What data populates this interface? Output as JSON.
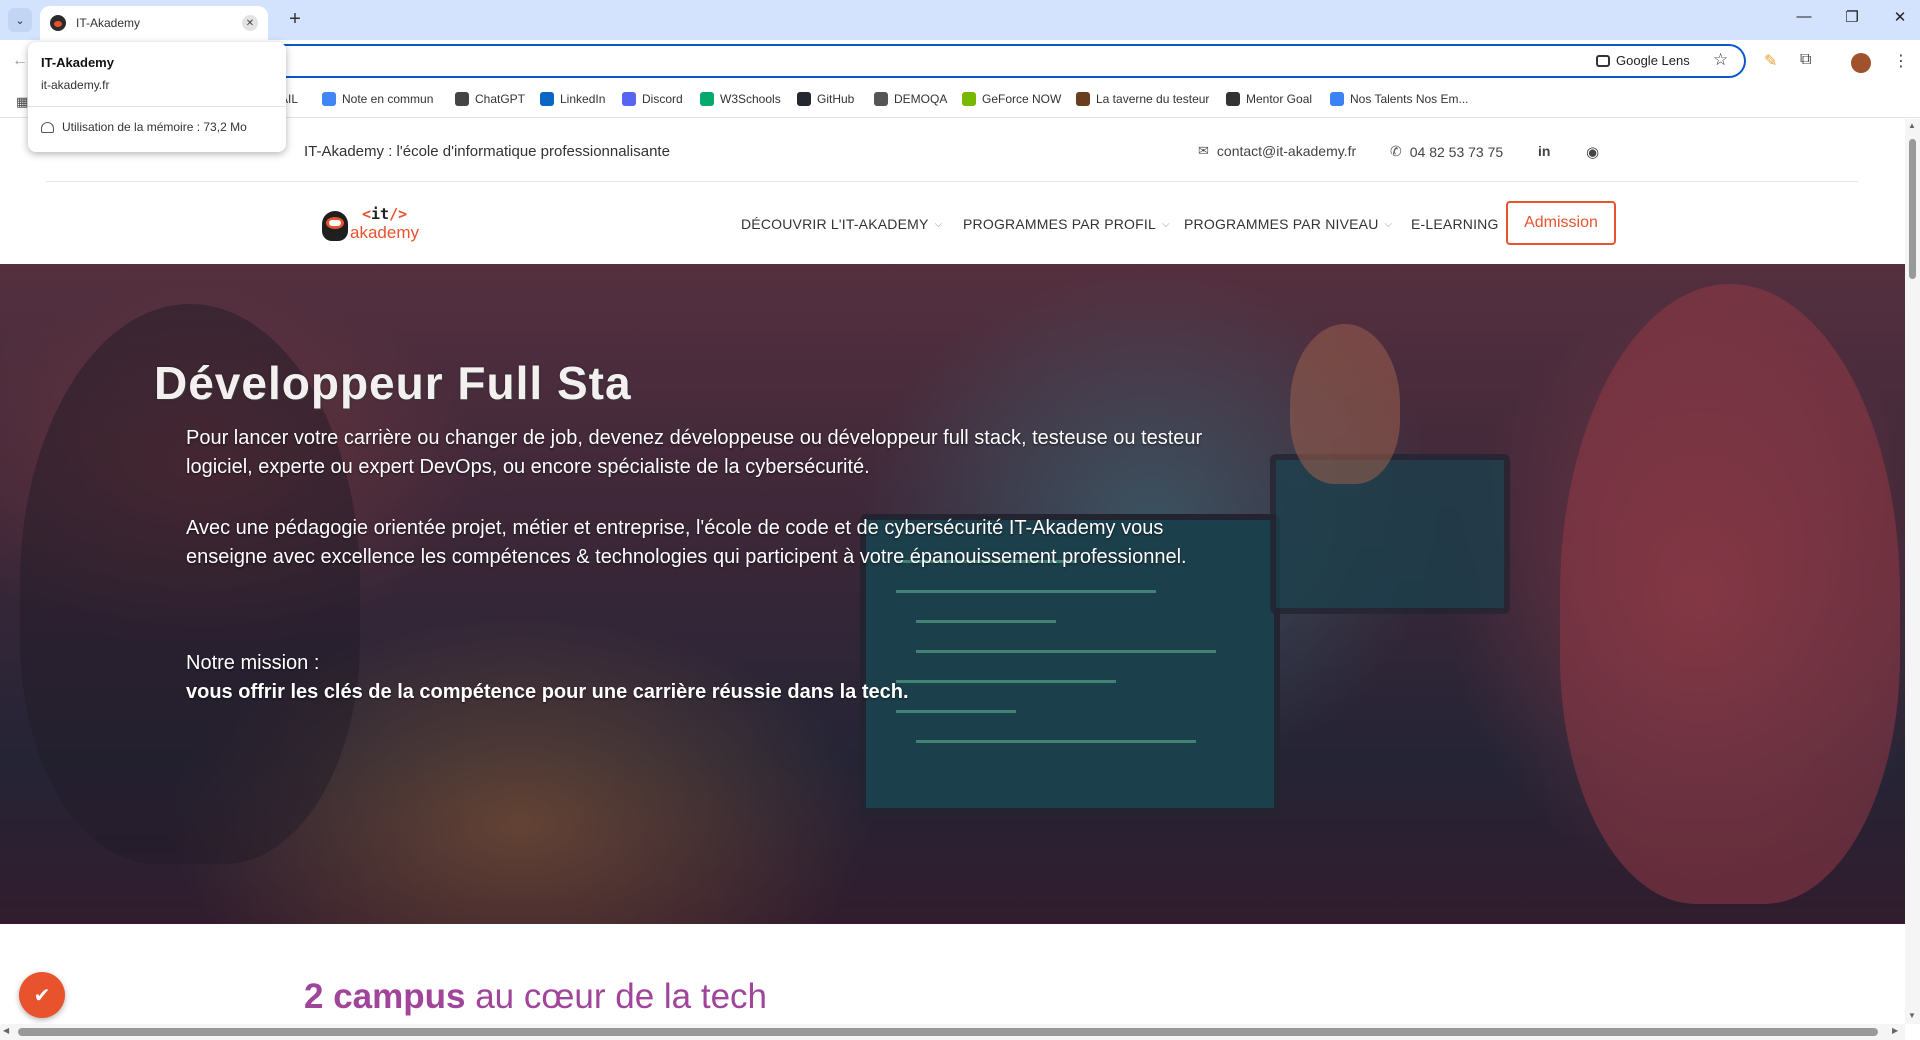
{
  "browser": {
    "tab_title": "IT-Akademy",
    "new_tab_symbol": "+",
    "tab_close_symbol": "✕",
    "window_minimize": "—",
    "window_restore": "❐",
    "window_close": "✕",
    "google_lens_label": "Google Lens",
    "hover_card": {
      "title": "IT-Akademy",
      "url": "it-akademy.fr",
      "memory": "Utilisation de la mémoire : 73,2 Mo"
    },
    "bookmarks": [
      {
        "label": "MAIL",
        "color": "#ffffff"
      },
      {
        "label": "Note en commun",
        "color": "#4285f4"
      },
      {
        "label": "ChatGPT",
        "color": "#444444"
      },
      {
        "label": "LinkedIn",
        "color": "#0a66c2"
      },
      {
        "label": "Discord",
        "color": "#5865f2"
      },
      {
        "label": "W3Schools",
        "color": "#04aa6d"
      },
      {
        "label": "GitHub",
        "color": "#24292f"
      },
      {
        "label": "DEMOQA",
        "color": "#555555"
      },
      {
        "label": "GeForce NOW",
        "color": "#76b900"
      },
      {
        "label": "La taverne du testeur",
        "color": "#6b3d1f"
      },
      {
        "label": "Mentor Goal",
        "color": "#333333"
      },
      {
        "label": "Nos Talents Nos Em...",
        "color": "#3b82f6"
      }
    ]
  },
  "site": {
    "tagline": "IT-Akademy : l'école d'informatique professionnalisante",
    "email": "contact@it-akademy.fr",
    "phone": "04 82 53 73 75",
    "linkedin_label": "in",
    "logo": {
      "code": "it",
      "name": "akademy"
    },
    "nav": [
      {
        "label": "DÉCOUVRIR L'IT-AKADEMY",
        "has_dropdown": true
      },
      {
        "label": "PROGRAMMES PAR PROFIL",
        "has_dropdown": true
      },
      {
        "label": "PROGRAMMES PAR NIVEAU",
        "has_dropdown": true
      },
      {
        "label": "E-LEARNING",
        "has_dropdown": false
      }
    ],
    "admission_label": "Admission",
    "hero": {
      "title": "Développeur Full Sta",
      "paragraph1": "Pour lancer votre carrière ou changer de job, devenez développeuse ou développeur full stack, testeuse ou testeur logiciel, experte ou expert DevOps, ou encore spécialiste de la cybersécurité.",
      "paragraph2": "Avec une pédagogie orientée projet, métier et entreprise, l'école de code et de cybersécurité IT-Akademy vous enseigne avec excellence les compétences & technologies qui participent à votre épanouissement professionnel.",
      "mission_label": "Notre mission :",
      "mission_text": "vous offrir les clés de la compétence pour une carrière réussie dans la tech."
    },
    "campus": {
      "bold": "2 campus",
      "rest": " au cœur de la tech"
    },
    "accent_color": "#e8532e",
    "campus_color": "#a0459a"
  }
}
